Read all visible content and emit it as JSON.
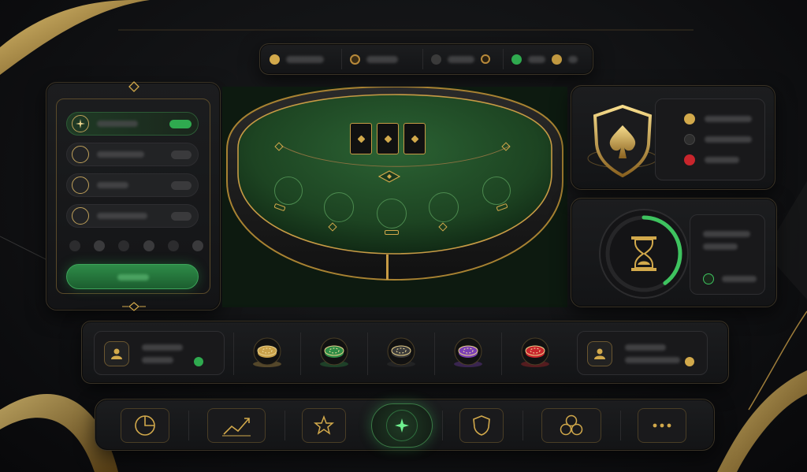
{
  "colors": {
    "gold": "#d2a94b",
    "felt": "#1f4a26",
    "accent_green": "#2faa4f",
    "red": "#c8252c",
    "purple": "#7b3fb5"
  },
  "top_bar": {
    "items": [
      {
        "icon": "gold-coin-icon"
      },
      {
        "icon": "gold-token-icon"
      },
      {
        "icon": "status-dot-icon"
      },
      {
        "icon": "green-online-icon"
      },
      {
        "icon": "gold-coin-icon"
      }
    ]
  },
  "left_panel": {
    "options": [
      {
        "icon": "sparkle-icon",
        "state": "selected"
      },
      {
        "icon": "radio-icon",
        "state": "unselected"
      },
      {
        "icon": "radio-icon",
        "state": "unselected"
      },
      {
        "icon": "radio-icon",
        "state": "unselected"
      }
    ],
    "pager_dots": 6,
    "confirm_button_icon": "confirm-button"
  },
  "table": {
    "community_cards": 3,
    "seats": 5
  },
  "security_panel": {
    "icon": "spade-shield-icon",
    "indicators": [
      "gold",
      "dark",
      "red"
    ]
  },
  "timer_panel": {
    "icon": "hourglass-icon",
    "progress": 0.4
  },
  "chips": [
    "gold-chip-icon",
    "green-chip-icon",
    "black-chip-icon",
    "purple-chip-icon",
    "red-chip-icon"
  ],
  "players": [
    {
      "icon": "user-icon",
      "status_color": "#2faa4f"
    },
    {
      "icon": "user-icon",
      "status_color": "#d2a94b"
    }
  ],
  "bottom_nav": [
    "pie-chart-icon",
    "trend-chart-icon",
    "star-icon",
    "home-gem-icon",
    "shield-icon",
    "clubs-icon",
    "more-icon"
  ]
}
